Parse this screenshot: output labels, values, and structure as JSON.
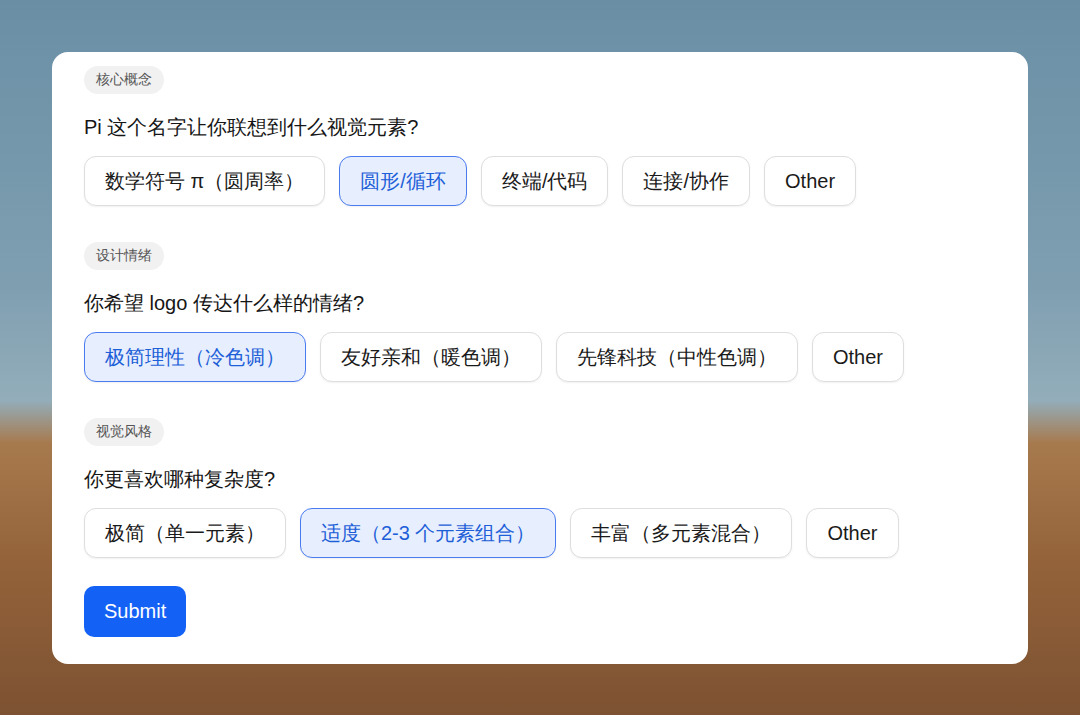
{
  "sections": [
    {
      "tag": "核心概念",
      "question": "Pi 这个名字让你联想到什么视觉元素?",
      "options": [
        {
          "label": "数学符号 π（圆周率）",
          "selected": false
        },
        {
          "label": "圆形/循环",
          "selected": true
        },
        {
          "label": "终端/代码",
          "selected": false
        },
        {
          "label": "连接/协作",
          "selected": false
        },
        {
          "label": "Other",
          "selected": false
        }
      ]
    },
    {
      "tag": "设计情绪",
      "question": "你希望 logo 传达什么样的情绪?",
      "options": [
        {
          "label": "极简理性（冷色调）",
          "selected": true
        },
        {
          "label": "友好亲和（暖色调）",
          "selected": false
        },
        {
          "label": "先锋科技（中性色调）",
          "selected": false
        },
        {
          "label": "Other",
          "selected": false
        }
      ]
    },
    {
      "tag": "视觉风格",
      "question": "你更喜欢哪种复杂度?",
      "options": [
        {
          "label": "极简（单一元素）",
          "selected": false
        },
        {
          "label": "适度（2-3 个元素组合）",
          "selected": true
        },
        {
          "label": "丰富（多元素混合）",
          "selected": false
        },
        {
          "label": "Other",
          "selected": false
        }
      ]
    }
  ],
  "submit": "Submit"
}
